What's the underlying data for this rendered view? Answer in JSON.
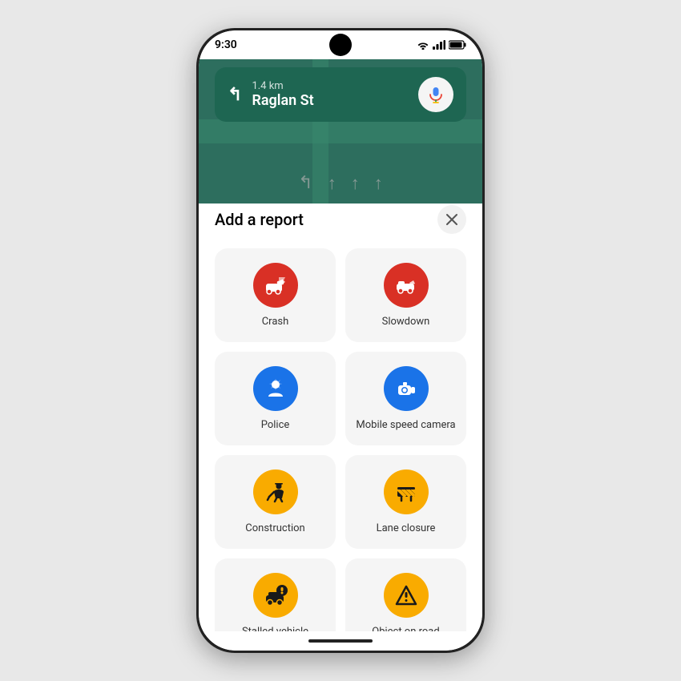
{
  "statusBar": {
    "time": "9:30"
  },
  "navigation": {
    "distance": "1.4 km",
    "street": "Raglan St"
  },
  "sheet": {
    "title": "Add a report",
    "closeLabel": "×"
  },
  "reports": [
    {
      "id": "crash",
      "label": "Crash",
      "iconColor": "red",
      "iconType": "crash"
    },
    {
      "id": "slowdown",
      "label": "Slowdown",
      "iconColor": "red",
      "iconType": "slowdown"
    },
    {
      "id": "police",
      "label": "Police",
      "iconColor": "blue",
      "iconType": "police"
    },
    {
      "id": "mobile-speed-camera",
      "label": "Mobile speed\ncamera",
      "iconColor": "blue",
      "iconType": "camera"
    },
    {
      "id": "construction",
      "label": "Construction",
      "iconColor": "yellow",
      "iconType": "construction"
    },
    {
      "id": "lane-closure",
      "label": "Lane closure",
      "iconColor": "yellow",
      "iconType": "lane"
    },
    {
      "id": "stalled-vehicle",
      "label": "Stalled vehicle",
      "iconColor": "yellow",
      "iconType": "stalled"
    },
    {
      "id": "object-on-road",
      "label": "Object on road",
      "iconColor": "yellow",
      "iconType": "object"
    }
  ]
}
